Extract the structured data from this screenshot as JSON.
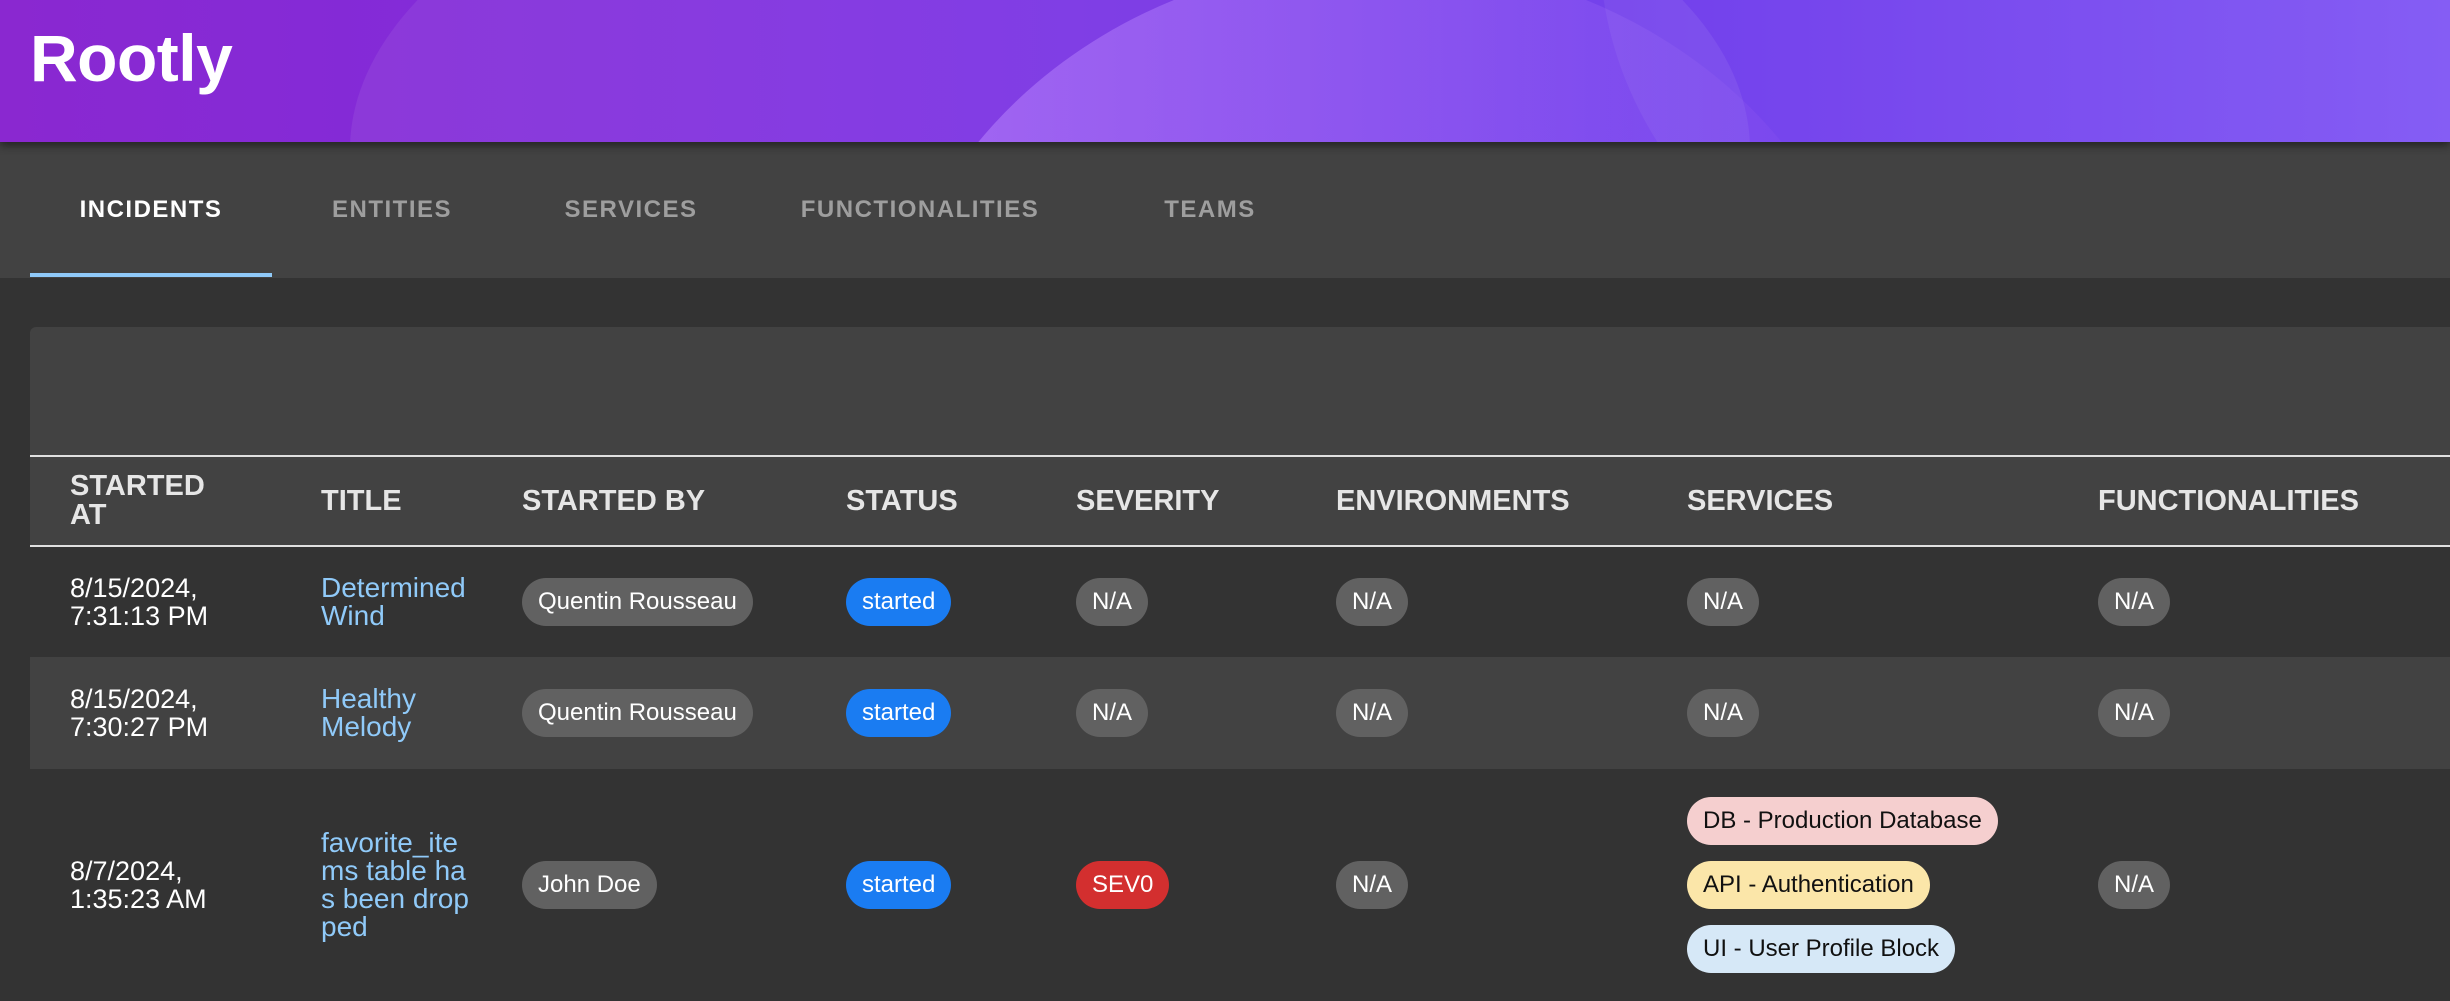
{
  "app": {
    "title": "Rootly"
  },
  "tabs": [
    "Incidents",
    "Entities",
    "Services",
    "Functionalities",
    "Teams"
  ],
  "table": {
    "headers": {
      "started_at": "STARTED AT",
      "title": "TITLE",
      "started_by": "STARTED BY",
      "status": "STATUS",
      "severity": "SEVERITY",
      "environments": "ENVIRONMENTS",
      "services": "SERVICES",
      "functionalities": "FUNCTIONALITIES"
    },
    "rows": [
      {
        "started_at": "8/15/2024, 7:31:13 PM",
        "title": "Determined Wind",
        "started_by": "Quentin Rousseau",
        "status": "started",
        "severity": "N/A",
        "environments": "N/A",
        "services": [
          "N/A"
        ],
        "functionalities": "N/A"
      },
      {
        "started_at": "8/15/2024, 7:30:27 PM",
        "title": "Healthy Melody",
        "started_by": "Quentin Rousseau",
        "status": "started",
        "severity": "N/A",
        "environments": "N/A",
        "services": [
          "N/A"
        ],
        "functionalities": "N/A"
      },
      {
        "started_at": "8/7/2024, 1:35:23 AM",
        "title": "favorite_items table has been dropped",
        "started_by": "John Doe",
        "status": "started",
        "severity": "SEV0",
        "environments": "N/A",
        "services": [
          "DB - Production Database",
          "API - Authentication",
          "UI - User Profile Block"
        ],
        "functionalities": "N/A"
      }
    ]
  },
  "colors": {
    "header_gradient_start": "#8a28d0",
    "header_gradient_end": "#7f55f4",
    "tab_indicator": "#90caf9",
    "link": "#90caf9",
    "status_started": "#1a7cf2",
    "sev0": "#d32f2f",
    "service_db": "#f5cfcf",
    "service_api": "#fbe6a9",
    "service_ui": "#d6e8f7"
  }
}
